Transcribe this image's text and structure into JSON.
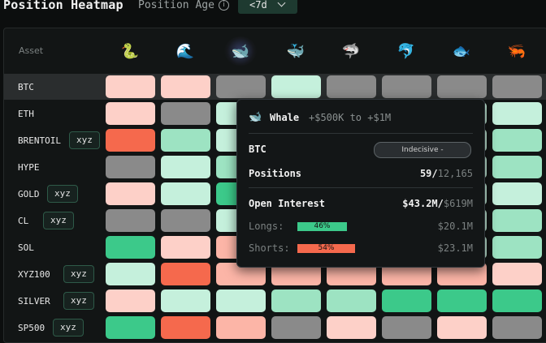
{
  "header": {
    "title": "Position Heatmap",
    "age_label": "Position Age",
    "age_value": "<7d",
    "info_icon": "info-icon"
  },
  "table": {
    "asset_header": "Asset",
    "columns": [
      {
        "icon": "snake-icon",
        "glyph": "🐍"
      },
      {
        "icon": "wave-icon",
        "glyph": "🌊"
      },
      {
        "icon": "whale-icon",
        "glyph": "🐋",
        "active": true
      },
      {
        "icon": "small-whale-icon",
        "glyph": "🐳"
      },
      {
        "icon": "shark-icon",
        "glyph": "🦈"
      },
      {
        "icon": "dolphin-icon",
        "glyph": "🐬"
      },
      {
        "icon": "fish-icon",
        "glyph": "🐟"
      },
      {
        "icon": "shrimp-icon",
        "glyph": "🦐"
      }
    ],
    "rows": [
      {
        "asset": "BTC",
        "badge": "",
        "cells": [
          "lpink",
          "lpink",
          "gray",
          "lgreen",
          "gray",
          "gray",
          "gray",
          "gray"
        ]
      },
      {
        "asset": "ETH",
        "badge": "",
        "cells": [
          "lpink",
          "gray",
          "lgreen",
          "lgreen",
          "lgreen",
          "lgreen",
          "lgreen",
          "lgreen"
        ]
      },
      {
        "asset": "BRENTOIL",
        "badge": "xyz",
        "cells": [
          "red",
          "mgreen",
          "lgreen",
          "lgreen",
          "lgreen",
          "lgreen",
          "lgreen",
          "mgreen"
        ]
      },
      {
        "asset": "HYPE",
        "badge": "",
        "cells": [
          "gray",
          "lgreen",
          "mgreen",
          "lgreen",
          "lgreen",
          "lgreen",
          "lgreen",
          "mgreen"
        ]
      },
      {
        "asset": "GOLD",
        "badge": "xyz",
        "cells": [
          "lpink",
          "lgreen",
          "green",
          "lgreen",
          "lgreen",
          "lgreen",
          "lgreen",
          "lgreen"
        ]
      },
      {
        "asset": "CL",
        "badge": "xyz",
        "cells": [
          "gray",
          "gray",
          "lgreen",
          "lgreen",
          "lgreen",
          "lgreen",
          "lgreen",
          "mgreen"
        ]
      },
      {
        "asset": "SOL",
        "badge": "",
        "cells": [
          "green",
          "lpink",
          "pink",
          "lgreen",
          "lgreen",
          "lgreen",
          "lgreen",
          "mgreen"
        ]
      },
      {
        "asset": "XYZ100",
        "badge": "xyz",
        "cells": [
          "lgreen",
          "red",
          "pink",
          "pink",
          "pink",
          "pink",
          "pink",
          "lpink"
        ]
      },
      {
        "asset": "SILVER",
        "badge": "xyz",
        "cells": [
          "lpink",
          "lgreen",
          "lgreen",
          "mgreen",
          "mgreen",
          "green",
          "green",
          "green"
        ]
      },
      {
        "asset": "SP500",
        "badge": "xyz",
        "cells": [
          "green",
          "red",
          "pink",
          "gray",
          "lpink",
          "gray",
          "lpink",
          "gray"
        ]
      }
    ],
    "colors": {
      "lpink": "#fdd0c8",
      "pink": "#fcb5a7",
      "red": "#f5694d",
      "gray": "#8a8a8a",
      "lgreen": "#c5f0dc",
      "mgreen": "#9de3c2",
      "green": "#3cc98a"
    }
  },
  "tooltip": {
    "icon": "whale-icon",
    "glyph": "🐋",
    "title": "Whale",
    "range": "+$500K to +$1M",
    "asset": "BTC",
    "sentiment": "Indecisive -",
    "positions_label": "Positions",
    "positions_value": "59/",
    "positions_total": "12,165",
    "oi_label": "Open Interest",
    "oi_value": "$43.2M/",
    "oi_total": "$619M",
    "longs_label": "Longs:",
    "longs_pct": "46%",
    "longs_fill": 0.46,
    "longs_value": "$20.1M",
    "shorts_label": "Shorts:",
    "shorts_pct": "54%",
    "shorts_fill": 0.54,
    "shorts_value": "$23.1M",
    "long_color": "#3cc98a",
    "short_color": "#f5694d"
  }
}
